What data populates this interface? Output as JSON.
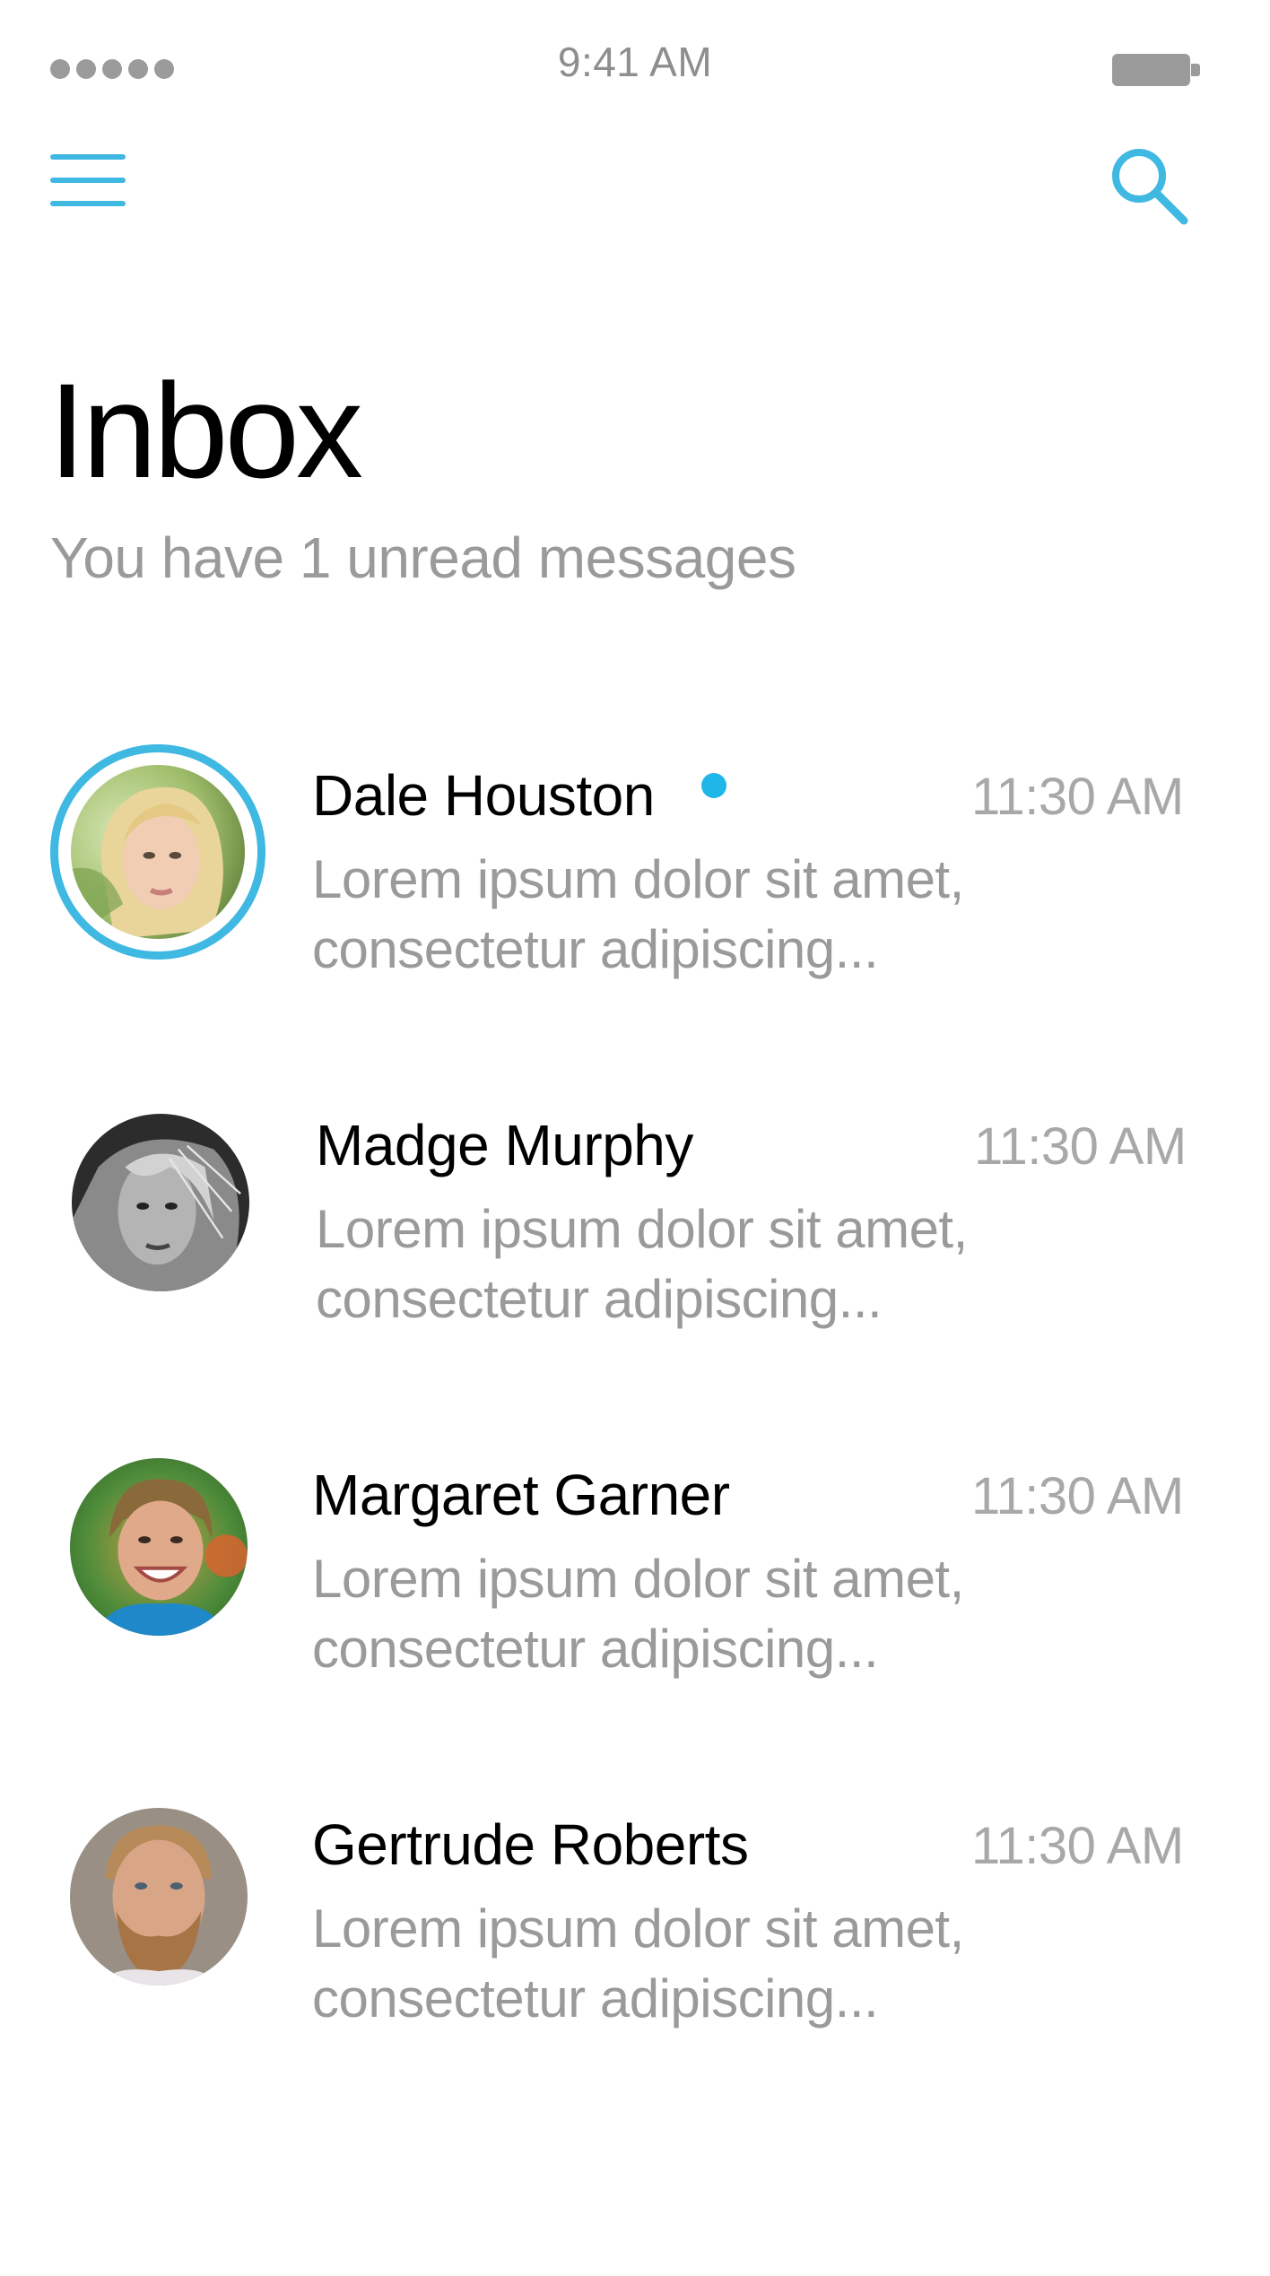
{
  "status_bar": {
    "time": "9:41 AM",
    "signal_icon": "signal-dots-icon",
    "battery_icon": "battery-icon"
  },
  "toolbar": {
    "menu_icon": "hamburger-menu-icon",
    "search_icon": "search-icon",
    "accent_color": "#3fb8e2"
  },
  "header": {
    "title": "Inbox",
    "subtitle": "You have 1 unread messages"
  },
  "conversations": [
    {
      "name": "Dale Houston",
      "time": "11:30 AM",
      "preview_line1": "Lorem ipsum dolor sit amet,",
      "preview_line2": "consectetur adipiscing...",
      "unread": true
    },
    {
      "name": "Madge Murphy",
      "time": "11:30 AM",
      "preview_line1": "Lorem ipsum dolor sit amet,",
      "preview_line2": "consectetur adipiscing...",
      "unread": false
    },
    {
      "name": "Margaret Garner",
      "time": "11:30 AM",
      "preview_line1": "Lorem ipsum dolor sit amet,",
      "preview_line2": "consectetur adipiscing...",
      "unread": false
    },
    {
      "name": "Gertrude Roberts",
      "time": "11:30 AM",
      "preview_line1": "Lorem ipsum dolor sit amet,",
      "preview_line2": "consectetur adipiscing...",
      "unread": false
    }
  ],
  "colors": {
    "unread_dot": "#1fb6e8",
    "secondary_text": "#9a9a9a"
  }
}
